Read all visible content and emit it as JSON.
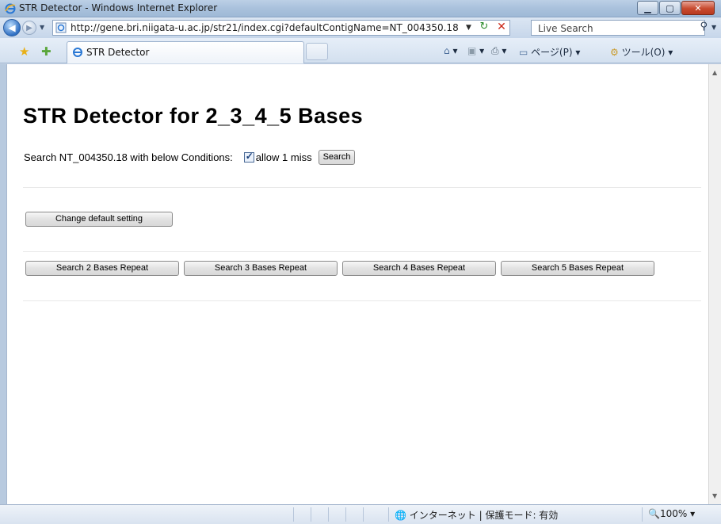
{
  "window": {
    "title": "STR Detector - Windows Internet Explorer"
  },
  "addressbar": {
    "url": "http://gene.bri.niigata-u.ac.jp/str21/index.cgi?defaultContigName=NT_004350.18",
    "search_placeholder": "Live Search"
  },
  "tabbar": {
    "tab_label": "STR Detector",
    "page_menu": "ページ(P)",
    "tools_menu": "ツール(O)"
  },
  "page": {
    "heading": "STR Detector for 2_3_4_5 Bases",
    "condition_text": "Search NT_004350.18 with below Conditions:",
    "allow_miss_label": "allow 1 miss",
    "allow_miss_checked": true,
    "search_button": "Search",
    "change_default_button": "Change default setting",
    "repeat_buttons": [
      "Search 2 Bases Repeat",
      "Search 3 Bases Repeat",
      "Search 4 Bases Repeat",
      "Search 5 Bases Repeat"
    ]
  },
  "statusbar": {
    "zone_text": "インターネット | 保護モード: 有効",
    "zoom": "100%"
  }
}
